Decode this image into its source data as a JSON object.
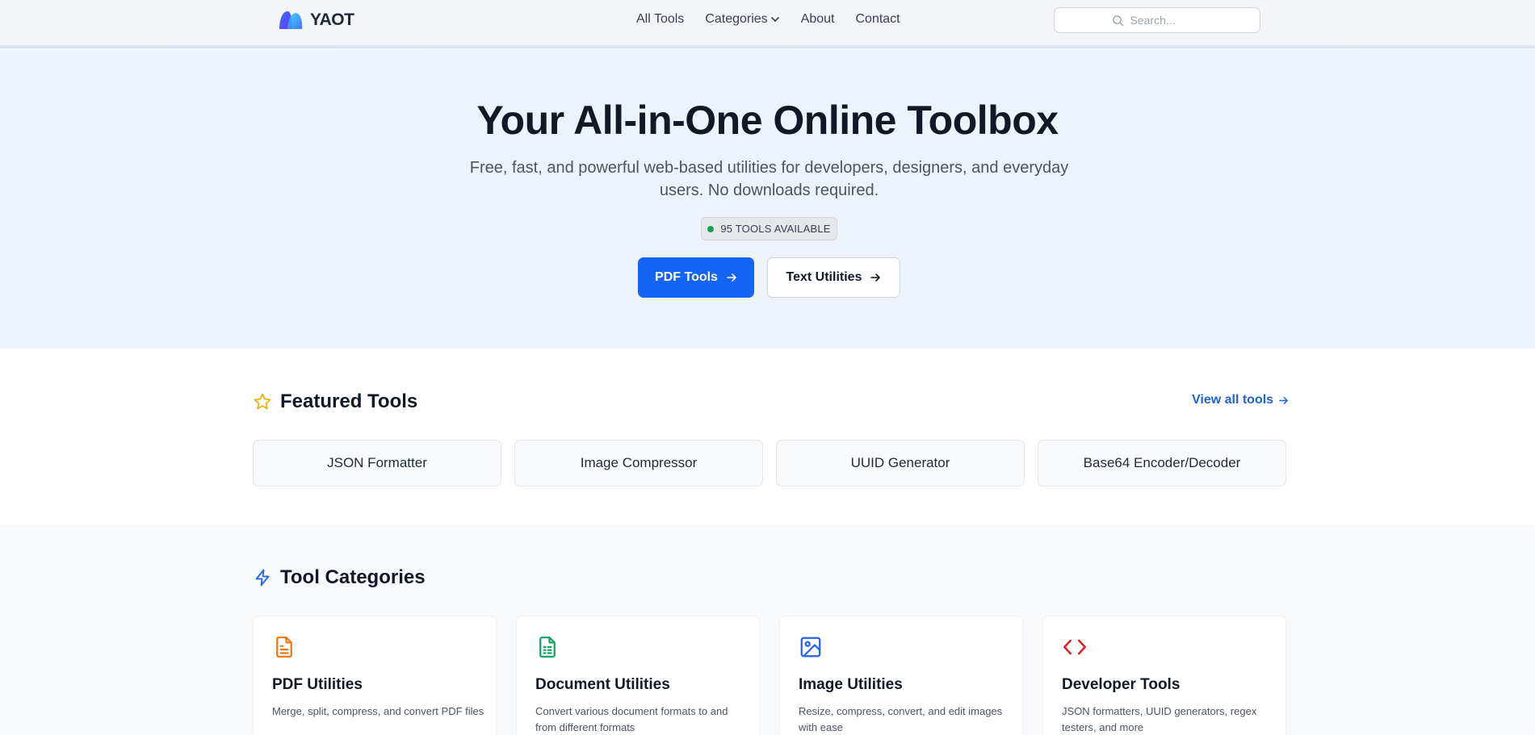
{
  "header": {
    "logo_text": "YAOT",
    "nav": [
      {
        "label": "All Tools"
      },
      {
        "label": "Categories"
      },
      {
        "label": "About"
      },
      {
        "label": "Contact"
      }
    ],
    "search_placeholder": "Search..."
  },
  "hero": {
    "title": "Your All-in-One Online Toolbox",
    "subtitle": "Free, fast, and powerful web-based utilities for developers, designers, and everyday users. No downloads required.",
    "badge": "95 TOOLS AVAILABLE",
    "primary_button": "PDF Tools",
    "secondary_button": "Text Utilities"
  },
  "featured": {
    "title": "Featured Tools",
    "view_all": "View all tools",
    "tools": [
      "JSON Formatter",
      "Image Compressor",
      "UUID Generator",
      "Base64 Encoder/Decoder"
    ]
  },
  "categories": {
    "title": "Tool Categories",
    "items": [
      {
        "title": "PDF Utilities",
        "desc": "Merge, split, compress, and convert PDF files",
        "icon": "file-text-icon",
        "color": "#ea7a19"
      },
      {
        "title": "Document Utilities",
        "desc": "Convert various document formats to and from different formats",
        "icon": "file-spreadsheet-icon",
        "color": "#12a36b"
      },
      {
        "title": "Image Utilities",
        "desc": "Resize, compress, convert, and edit images with ease",
        "icon": "image-icon",
        "color": "#2563eb"
      },
      {
        "title": "Developer Tools",
        "desc": "JSON formatters, UUID generators, regex testers, and more",
        "icon": "code-icon",
        "color": "#dc2626"
      }
    ]
  },
  "colors": {
    "primary": "#1565f5",
    "link": "#1d62d8",
    "star": "#eab308",
    "bolt": "#2563eb",
    "badge_dot": "#16a34a"
  }
}
